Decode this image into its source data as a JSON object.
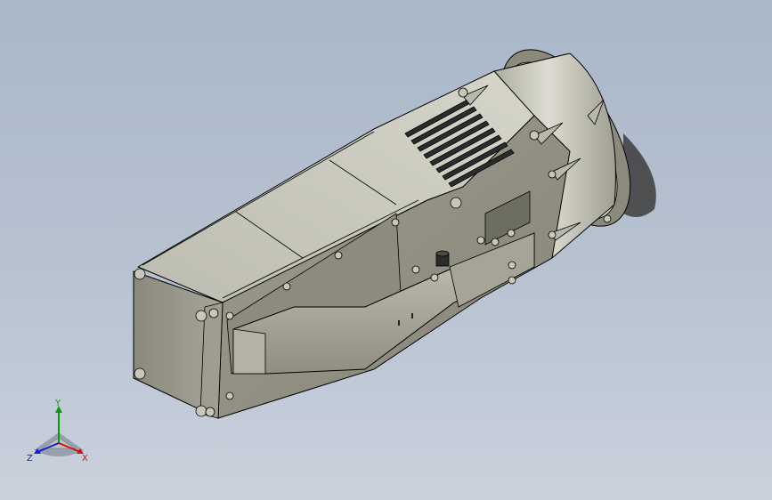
{
  "view": {
    "background_top": "#a9b7c9",
    "background_bottom": "#c9d1dc"
  },
  "model": {
    "body_color": "#a8a79a",
    "body_shadow": "#7f7e72",
    "edge_color": "#000000"
  },
  "triad": {
    "x_label": "X",
    "y_label": "Y",
    "z_label": "Z",
    "x_color": "#d01010",
    "y_color": "#0a9a0a",
    "z_color": "#1020d0"
  }
}
